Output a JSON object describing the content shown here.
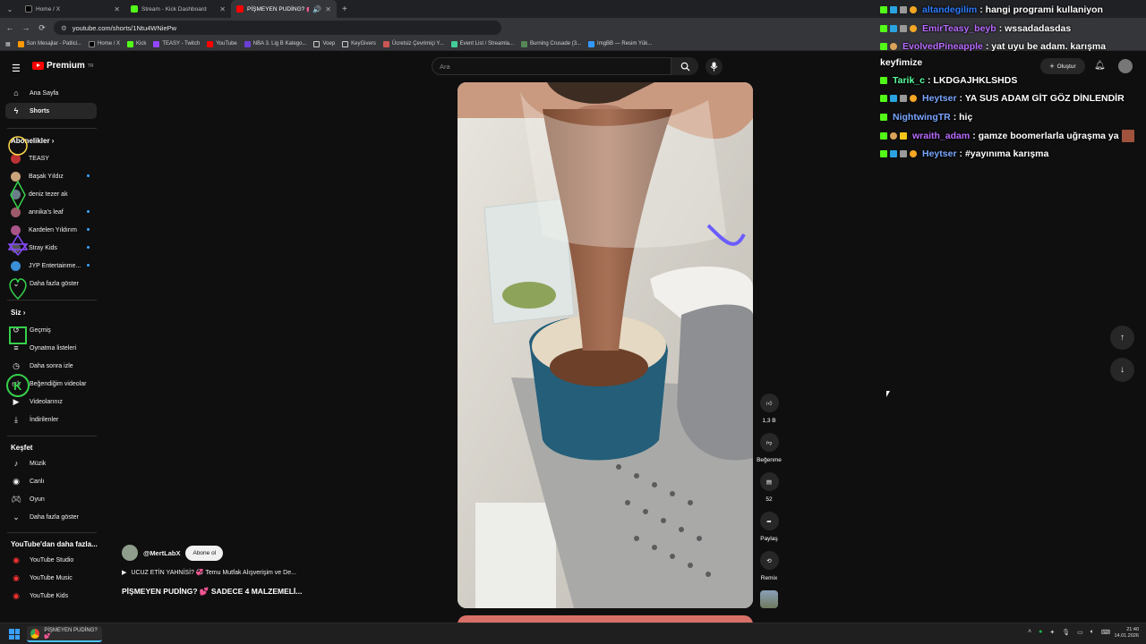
{
  "browser": {
    "tabs": [
      {
        "title": "Home / X",
        "color": "#000000"
      },
      {
        "title": "Stream - Kick Dashboard",
        "color": "#53fc18"
      },
      {
        "title": "PİŞMEYEN PUDİNG? 💕 SA",
        "color": "#ff0000"
      }
    ],
    "url": "youtube.com/shorts/1Ntu4WNiePw",
    "bookmarks": [
      "Son Mesajlar - Patlici...",
      "Home / X",
      "Kick",
      "TEASY - Twitch",
      "YouTube",
      "NBA 3. Lig B Katego...",
      "Voep",
      "KeyGivers",
      "Ücretsiz Çevrimiçi Y...",
      "Event List / Streamla...",
      "Burning Crusade (3...",
      "ImgBB — Resim Yük..."
    ]
  },
  "youtube": {
    "logo": "Premium",
    "logo_sup": "TR",
    "search_placeholder": "Ara",
    "create_label": "Oluştur",
    "sidebar": {
      "home": "Ana Sayfa",
      "shorts": "Shorts",
      "subscriptions_title": "Abonelikler",
      "subscriptions": [
        {
          "name": "TEASY",
          "color": "#b33"
        },
        {
          "name": "Başak Yıldız",
          "color": "#c9a37a"
        },
        {
          "name": "deniz tezer ak",
          "color": "#6a7d8a"
        },
        {
          "name": "annika's leaf",
          "color": "#9c5a6b"
        },
        {
          "name": "Kardelen Yıldırım",
          "color": "#a58",
          "x": 0
        },
        {
          "name": "Stray Kids",
          "color": "#555"
        },
        {
          "name": "JYP Entertainme...",
          "color": "#3a8fd8"
        }
      ],
      "show_more": "Daha fazla göster",
      "you_title": "Siz",
      "you_items": [
        "Geçmiş",
        "Oynatma listeleri",
        "Daha sonra izle",
        "Beğendiğim videolar",
        "Videolarınız",
        "İndirilenler"
      ],
      "explore_title": "Keşfet",
      "explore_items": [
        "Müzik",
        "Canlı",
        "Oyun",
        "Daha fazla göster"
      ],
      "more_title": "YouTube'dan daha fazla...",
      "more_items": [
        "YouTube Studio",
        "YouTube Music",
        "YouTube Kids"
      ]
    },
    "short": {
      "channel": "@MertLabX",
      "subscribe": "Abone ol",
      "related": "UCUZ ETİN YAHNİSİ? 💞 Temu Mutfak Alışverişim ve De...",
      "title": "PİŞMEYEN PUDİNG? 💕 SADECE 4 MALZEMELİ...",
      "likes": "1,3 B",
      "dislike": "Beğenme",
      "comments": "52",
      "share": "Paylaş",
      "remix": "Remix"
    }
  },
  "chat": [
    {
      "user": "altandegilim",
      "text": ": hangi programi kullaniyon",
      "color": "#2e7bff"
    },
    {
      "user": "EmirTeasy_beyb",
      "text": ": wssadadasdas",
      "color": "#b86bff"
    },
    {
      "user": "EvolvedPineapple",
      "text": ": yat uyu be adam. karışma",
      "color": "#b86bff"
    },
    {
      "user": "",
      "text": "keyfimize",
      "color": "#ffffff"
    },
    {
      "user": "Tarik_c",
      "text": ": LKDGAJHKLSHDS",
      "color": "#5bffa0"
    },
    {
      "user": "Heytser",
      "text": ": YA SUS ADAM GİT GÖZ DİNLENDİR",
      "color": "#7aa7ff"
    },
    {
      "user": "NightwingTR",
      "text": ": hiç",
      "color": "#7aa7ff"
    },
    {
      "user": "wraith_adam",
      "text": ": gamze boomerlarla uğraşma ya",
      "color": "#b86bff"
    },
    {
      "user": "Heytser",
      "text": ": #yayınıma karışma",
      "color": "#7aa7ff"
    }
  ],
  "taskbar": {
    "app_title": "PİŞMEYEN PUDİNG? 💕",
    "time": "21:40",
    "date": "14.01.2026"
  }
}
